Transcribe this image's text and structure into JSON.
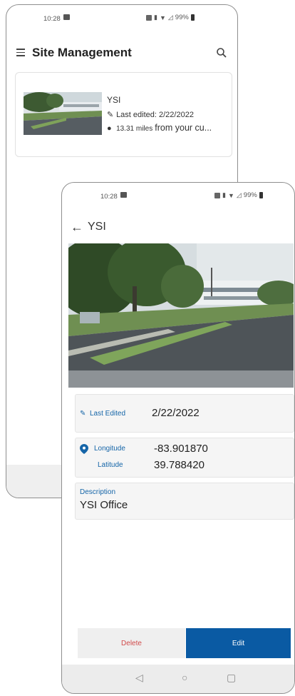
{
  "back_screen": {
    "status": {
      "time": "10:28",
      "battery": "99%"
    },
    "title": "Site Management",
    "site": {
      "name": "YSI",
      "last_edited_label": "Last edited:",
      "last_edited_date": "2/22/2022",
      "distance_value": "13.31 miles",
      "distance_rest": "from your cu..."
    }
  },
  "front_screen": {
    "status": {
      "time": "10:28",
      "battery": "99%"
    },
    "title": "YSI",
    "last_edited": {
      "label": "Last Edited",
      "value": "2/22/2022"
    },
    "location": {
      "longitude_label": "Longitude",
      "longitude_value": "-83.901870",
      "latitude_label": "Latitude",
      "latitude_value": "39.788420"
    },
    "description": {
      "label": "Description",
      "value": "YSI Office"
    },
    "buttons": {
      "delete": "Delete",
      "edit": "Edit"
    }
  },
  "colors": {
    "accent": "#0a5aa3",
    "delete": "#d14b4b",
    "label": "#1565a8"
  }
}
